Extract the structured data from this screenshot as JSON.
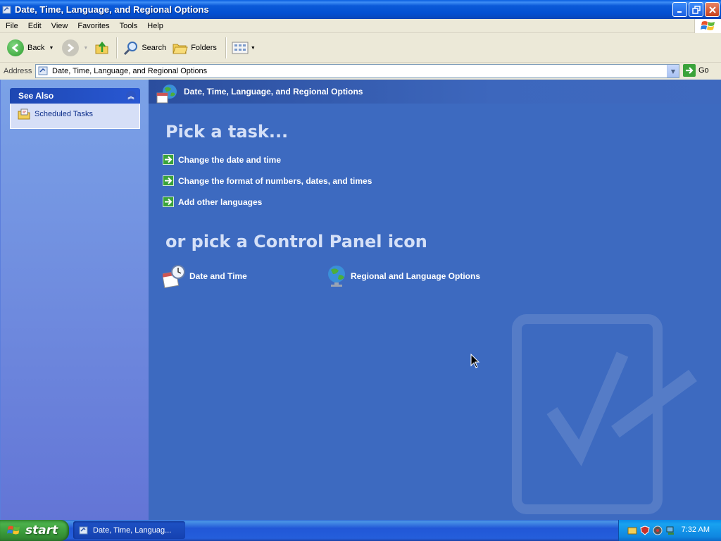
{
  "window": {
    "title": "Date, Time, Language, and Regional Options"
  },
  "menu": {
    "items": [
      "File",
      "Edit",
      "View",
      "Favorites",
      "Tools",
      "Help"
    ]
  },
  "toolbar": {
    "back_label": "Back",
    "search_label": "Search",
    "folders_label": "Folders"
  },
  "address": {
    "label": "Address",
    "value": "Date, Time, Language, and Regional Options",
    "go_label": "Go"
  },
  "sidebar": {
    "see_also": {
      "title": "See Also",
      "items": [
        {
          "label": "Scheduled Tasks",
          "icon": "scheduled-tasks-icon"
        }
      ]
    }
  },
  "main": {
    "header_title": "Date, Time, Language, and Regional Options",
    "pick_task_heading": "Pick a task...",
    "tasks": [
      {
        "label": "Change the date and time"
      },
      {
        "label": "Change the format of numbers, dates, and times"
      },
      {
        "label": "Add other languages"
      }
    ],
    "pick_icon_heading": "or pick a Control Panel icon",
    "icons": [
      {
        "label": "Date and Time",
        "icon": "date-time-icon"
      },
      {
        "label": "Regional and Language Options",
        "icon": "globe-icon"
      }
    ]
  },
  "taskbar": {
    "start_label": "start",
    "open_window_label": "Date, Time, Languag...",
    "clock": "7:32 AM"
  },
  "colors": {
    "titlebar": "#0350d2",
    "main_pane": "#3d6ac0",
    "sidebar": "#7ba2e7",
    "start_button": "#3a9a3a",
    "taskbar": "#245edb"
  }
}
